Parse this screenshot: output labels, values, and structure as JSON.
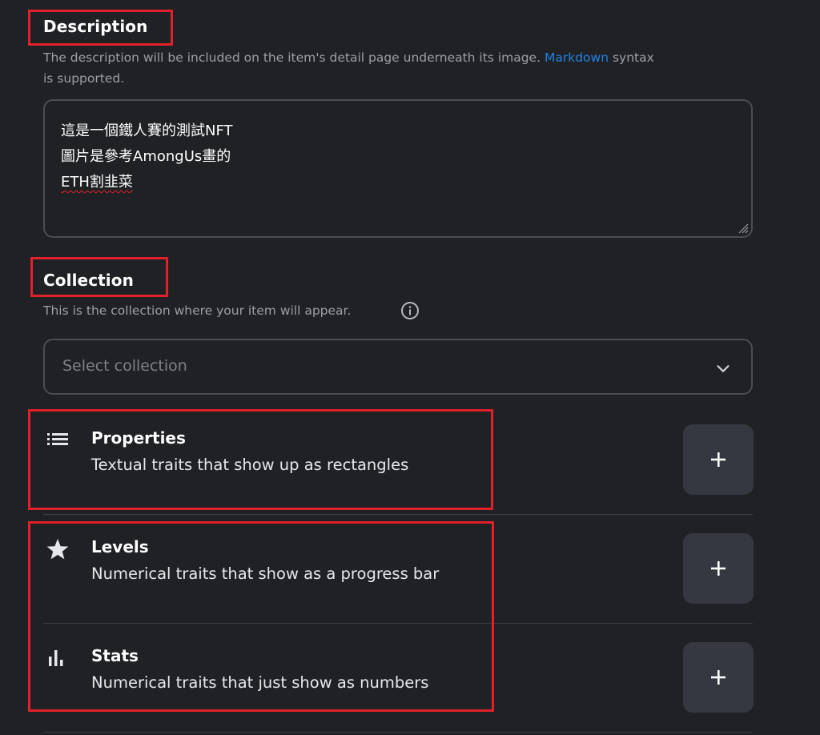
{
  "description": {
    "title": "Description",
    "helper_before_link": "The description will be included on the item's detail page underneath its image.",
    "helper_link": "Markdown",
    "helper_after_link": "syntax",
    "helper_line2": "is supported.",
    "lines": [
      "這是一個鐵人賽的測試NFT",
      "圖片是參考AmongUs畫的",
      "ETH割韭菜"
    ]
  },
  "collection": {
    "title": "Collection",
    "helper": "This is the collection where your item will appear.",
    "select_placeholder": "Select collection"
  },
  "traits": [
    {
      "title": "Properties",
      "description": "Textual traits that show up as rectangles",
      "icon": "list-icon",
      "button": "+"
    },
    {
      "title": "Levels",
      "description": "Numerical traits that show as a progress bar",
      "icon": "star-icon",
      "button": "+"
    },
    {
      "title": "Stats",
      "description": "Numerical traits that just show as numbers",
      "icon": "bar-chart-icon",
      "button": "+"
    }
  ],
  "colors": {
    "background": "#202124",
    "link": "#2081e2",
    "annotation": "#e0202b",
    "button_bg": "#353840"
  }
}
